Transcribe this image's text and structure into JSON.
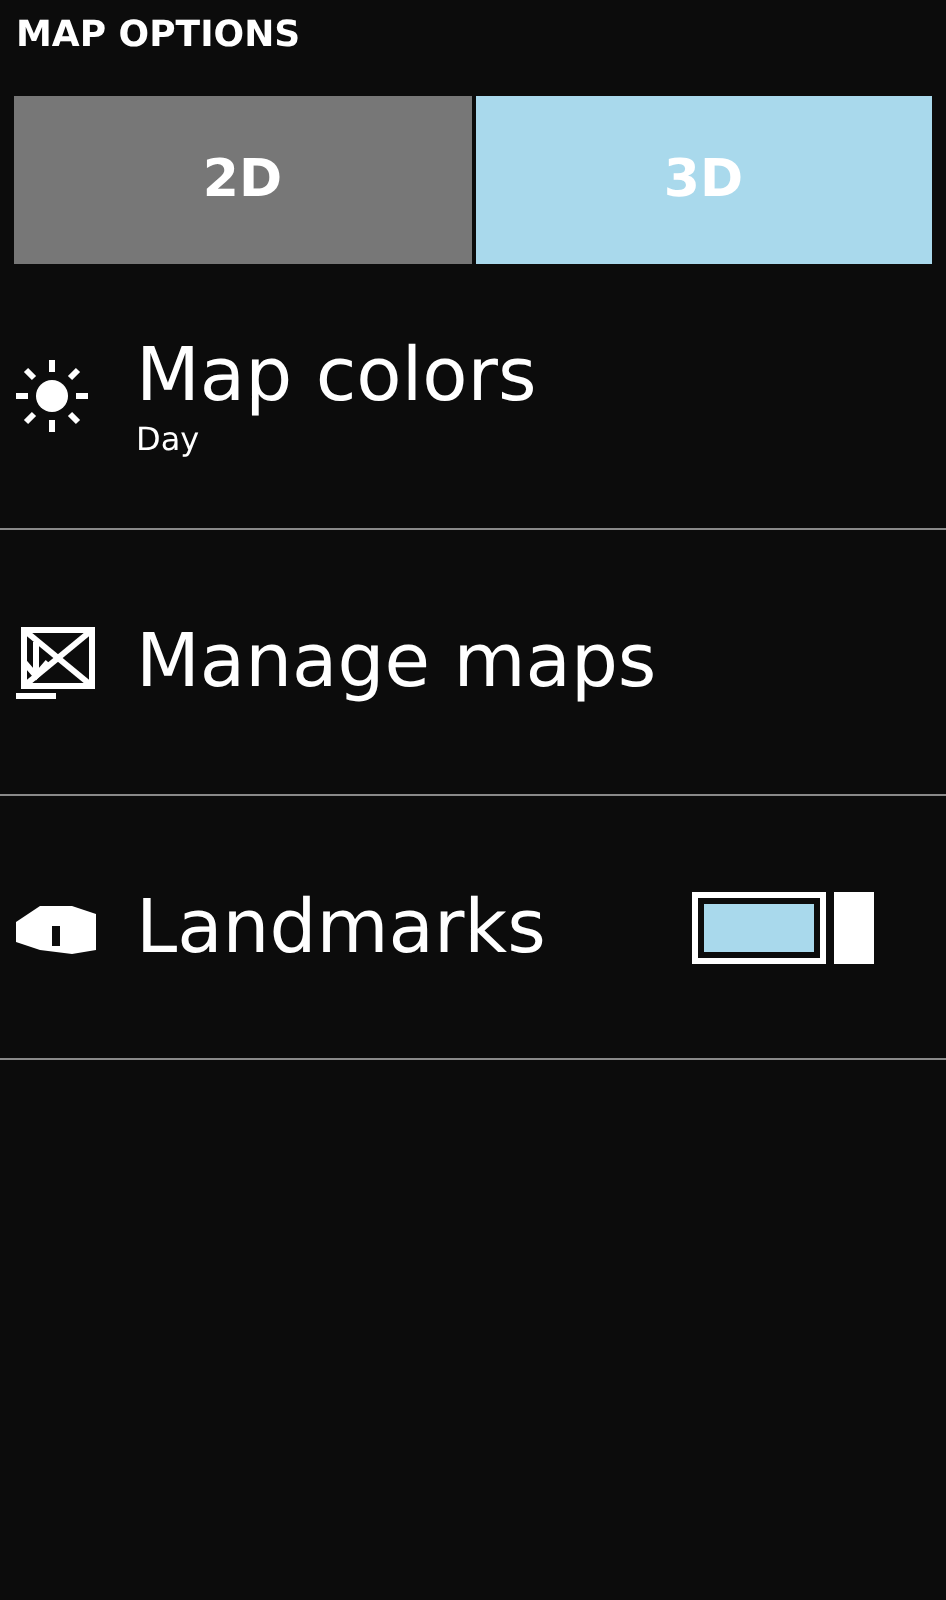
{
  "title": "MAP OPTIONS",
  "view_modes": [
    {
      "label": "2D",
      "selected": false
    },
    {
      "label": "3D",
      "selected": true
    }
  ],
  "items": [
    {
      "kind": "sun",
      "title": "Map colors",
      "subtitle": "Day"
    },
    {
      "kind": "maps",
      "title": "Manage maps"
    },
    {
      "kind": "landmarks",
      "title": "Landmarks",
      "on": true
    }
  ]
}
